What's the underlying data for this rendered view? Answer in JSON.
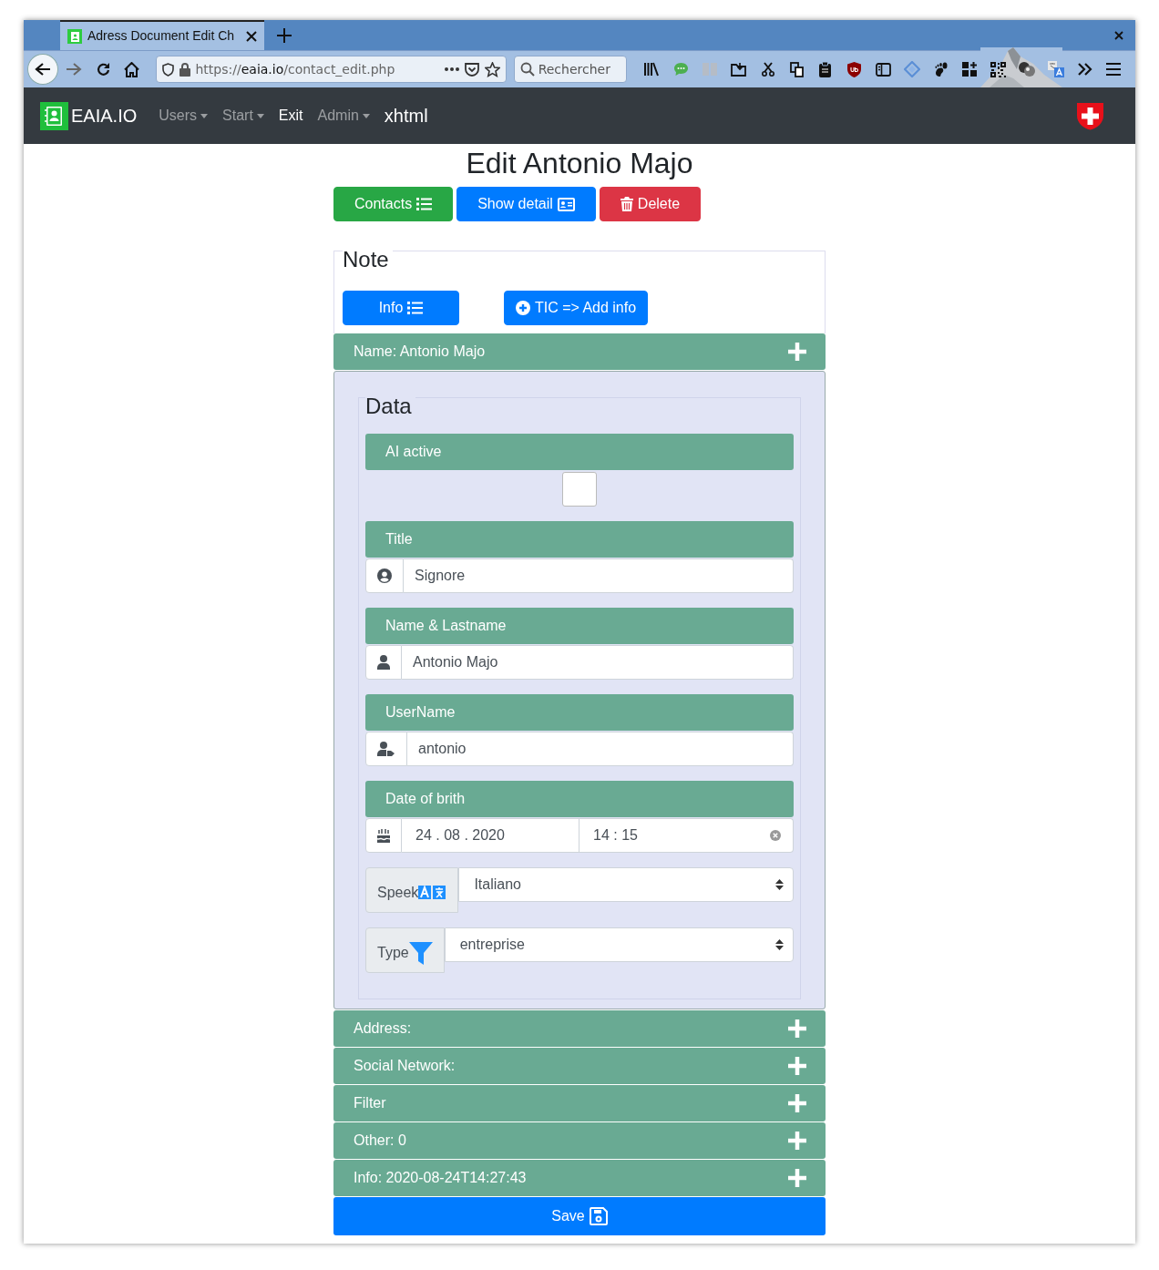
{
  "browser": {
    "tab_title": "Adress Document Edit Ch",
    "url_scheme": "https://",
    "url_host": "eaia.io",
    "url_path": "/contact_edit.php",
    "search_placeholder": "Rechercher"
  },
  "navbar": {
    "brand": "EAIA.IO",
    "items": [
      {
        "label": "Users",
        "kind": "dropdown",
        "active": false
      },
      {
        "label": "Start",
        "kind": "dropdown",
        "active": false
      },
      {
        "label": "Exit",
        "kind": "link",
        "active": true
      },
      {
        "label": "Admin",
        "kind": "dropdown",
        "active": false
      },
      {
        "label": "xhtml",
        "kind": "text",
        "active": true
      }
    ]
  },
  "page_title": "Edit Antonio Majo",
  "actions": [
    {
      "label": "Contacts"
    },
    {
      "label": "Show detail"
    },
    {
      "label": "Delete"
    }
  ],
  "note": {
    "legend": "Note",
    "buttons": [
      {
        "label": "Info"
      },
      {
        "label": "TIC => Add info"
      }
    ]
  },
  "name_section": {
    "label": "Name: Antonio Majo"
  },
  "data": {
    "legend": "Data",
    "fields": [
      {
        "kind": "checkbox",
        "label": "AI active",
        "checked": false
      },
      {
        "kind": "input",
        "label": "Title",
        "value": "Signore"
      },
      {
        "kind": "input",
        "label": "Name & Lastname",
        "value": "Antonio Majo"
      },
      {
        "kind": "input",
        "label": "UserName",
        "value": "antonio"
      },
      {
        "kind": "datetime",
        "label": "Date of brith",
        "date": "24 . 08 . 2020",
        "time": "14 : 15"
      },
      {
        "kind": "select",
        "label": "Speek",
        "value": "Italiano"
      },
      {
        "kind": "select",
        "label": "Type",
        "value": "entreprise"
      }
    ]
  },
  "sections": [
    {
      "label": "Address:"
    },
    {
      "label": "Social Network:"
    },
    {
      "label": "Filter"
    },
    {
      "label": "Other: 0"
    },
    {
      "label": "Info: 2020-08-24T14:27:43"
    }
  ],
  "save": {
    "label": "Save"
  }
}
